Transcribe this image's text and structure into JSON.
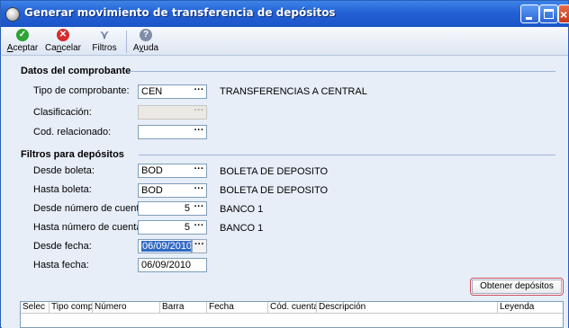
{
  "window": {
    "title": "Generar movimiento de transferencia de depósitos",
    "accent": "#2361d5"
  },
  "toolbar": {
    "aceptar": {
      "pre": "",
      "u": "A",
      "post": "ceptar",
      "icon": "check-circle-icon"
    },
    "cancelar": {
      "pre": "Ca",
      "u": "n",
      "post": "celar",
      "icon": "x-circle-icon"
    },
    "filtros": {
      "label": "Filtros",
      "icon": "funnel-icon"
    },
    "ayuda": {
      "pre": "A",
      "u": "y",
      "post": "uda",
      "icon": "help-icon"
    }
  },
  "datos": {
    "title": "Datos del comprobante",
    "tipo": {
      "label": "Tipo de comprobante:",
      "value": "CEN",
      "desc": "TRANSFERENCIAS A CENTRAL"
    },
    "clasificacion": {
      "label": "Clasificación:",
      "value": ""
    },
    "cod_relacionado": {
      "label": "Cod. relacionado:",
      "value": ""
    }
  },
  "filtros": {
    "title": "Filtros para depósitos",
    "desde_boleta": {
      "label": "Desde boleta:",
      "value": "BOD",
      "desc": "BOLETA DE DEPOSITO"
    },
    "hasta_boleta": {
      "label": "Hasta boleta:",
      "value": "BOD",
      "desc": "BOLETA DE DEPOSITO"
    },
    "desde_cuenta": {
      "label": "Desde número de cuenta:",
      "value": "5",
      "desc": "BANCO 1"
    },
    "hasta_cuenta": {
      "label": "Hasta número de cuenta:",
      "value": "5",
      "desc": "BANCO 1"
    },
    "desde_fecha": {
      "label": "Desde fecha:",
      "value": "06/09/2010"
    },
    "hasta_fecha": {
      "label": "Hasta fecha:",
      "value": "06/09/2010"
    }
  },
  "ellipsis": "···",
  "obtener_button": "Obtener depósitos",
  "grid": {
    "columns": [
      "Selec",
      "Tipo comp.",
      "Número",
      "Barra",
      "Fecha",
      "Cód. cuenta",
      "Descripción",
      "Leyenda"
    ]
  }
}
